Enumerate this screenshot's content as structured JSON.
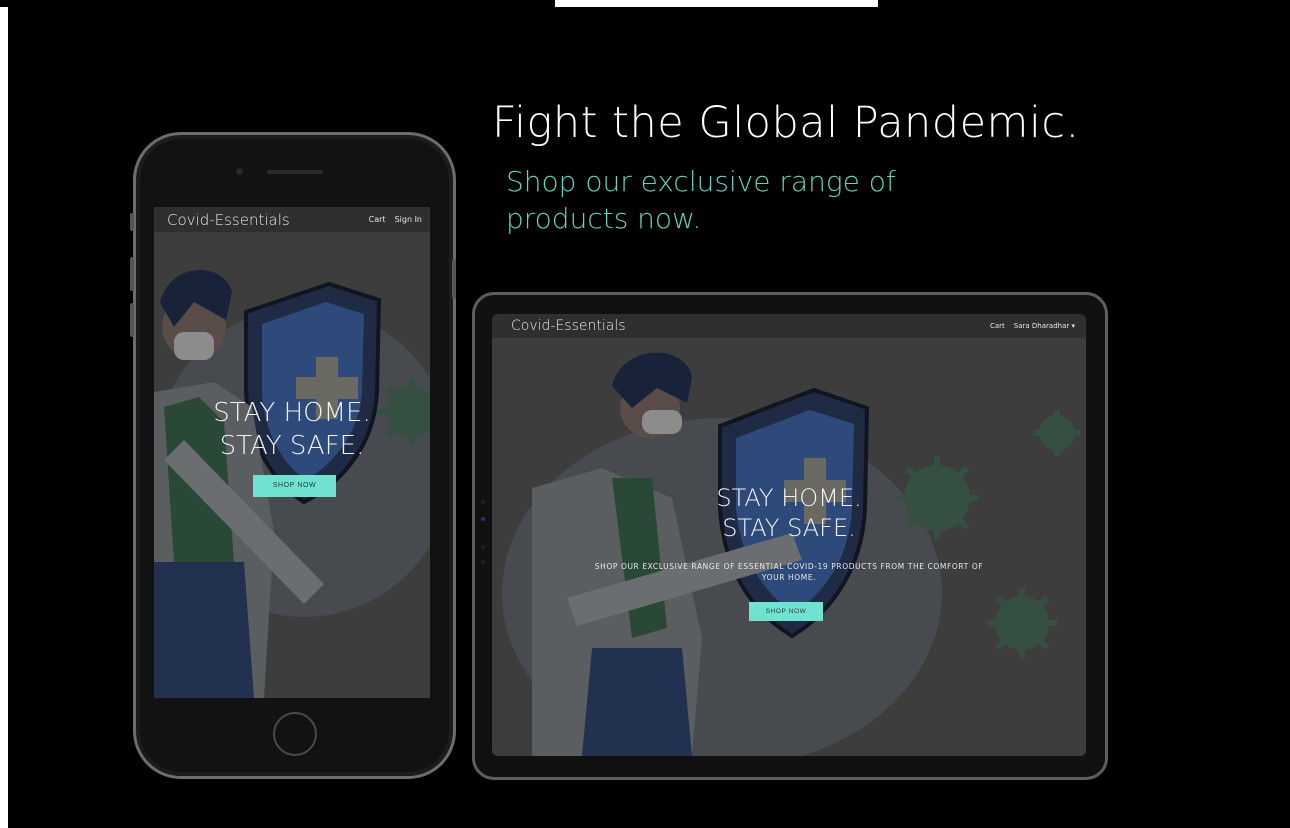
{
  "headline": "Fight the Global Pandemic.",
  "subheadline": "Shop our exclusive range of products now.",
  "phone": {
    "brand": "Covid-Essentials",
    "nav": [
      "Cart",
      "Sign In"
    ],
    "hero_line1": "STAY HOME.",
    "hero_line2": "STAY SAFE.",
    "button": "SHOP NOW"
  },
  "tablet": {
    "brand": "Covid-Essentials",
    "nav_cart": "Cart",
    "nav_user": "Sara Dharadhar",
    "hero_line1": "STAY HOME.",
    "hero_line2": "STAY SAFE.",
    "description": "SHOP OUR EXCLUSIVE RANGE OF ESSENTIAL COVID-19 PRODUCTS FROM THE COMFORT OF YOUR HOME.",
    "button": "SHOP NOW"
  },
  "icons": [
    "dropdown-caret-icon",
    "doctor-illustration",
    "shield-icon",
    "virus-icon"
  ],
  "colors": {
    "background": "#000000",
    "accent": "#5fd6c2",
    "button": "#6fe3d0",
    "navbar": "#2e2f31"
  }
}
